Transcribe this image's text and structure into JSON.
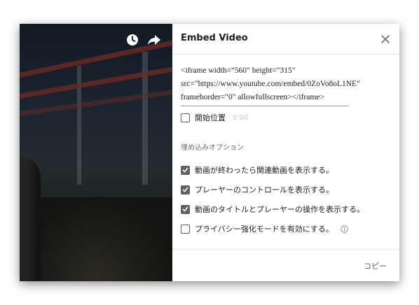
{
  "dialog": {
    "title": "Embed Video",
    "embed_code": "<iframe width=\"560\" height=\"315\" src=\"https://www.youtube.com/embed/0ZoVo8oL1NE\" frameborder=\"0\" allowfullscreen></iframe>",
    "start_at": {
      "label": "開始位置",
      "value": "0:00",
      "checked": false
    },
    "options_heading": "埋め込みオプション",
    "options": [
      {
        "label": "動画が終わったら関連動画を表示する。",
        "checked": true
      },
      {
        "label": "プレーヤーのコントロールを表示する。",
        "checked": true
      },
      {
        "label": "動画のタイトルとプレーヤーの操作を表示する。",
        "checked": true
      },
      {
        "label": "プライバシー強化モードを有効にする。",
        "checked": false
      }
    ],
    "copy_label": "コピー"
  },
  "video": {
    "icons": [
      "watch-later-icon",
      "share-icon"
    ]
  }
}
